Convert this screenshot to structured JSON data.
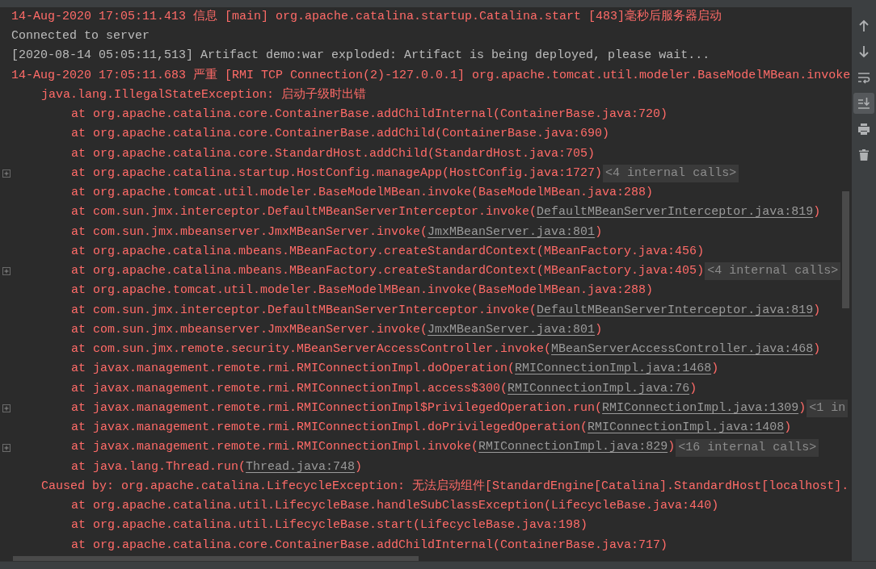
{
  "lines": [
    {
      "kind": "stderr",
      "segments": [
        {
          "text": "14-Aug-2020 17:05:11.413 信息 [main] org.apache.catalina.startup.Catalina.start [483]毫秒后服务器启动",
          "link": false
        }
      ]
    },
    {
      "kind": "stdout",
      "segments": [
        {
          "text": "Connected to server",
          "link": false
        }
      ]
    },
    {
      "kind": "stdout",
      "segments": [
        {
          "text": "[2020-08-14 05:05:11,513] Artifact demo:war exploded: Artifact is being deployed, please wait...",
          "link": false
        }
      ]
    },
    {
      "kind": "stderr",
      "segments": [
        {
          "text": "14-Aug-2020 17:05:11.683 严重 [RMI TCP Connection(2)-127.0.0.1] org.apache.tomcat.util.modeler.BaseModelMBean.invoke",
          "link": false
        }
      ],
      "children": [
        {
          "kind": "stderr",
          "segments": [
            {
              "text": "java.lang.IllegalStateException: 启动子级时出错",
              "link": false
            }
          ],
          "children": [
            {
              "kind": "stderr",
              "segments": [
                {
                  "text": "at org.apache.catalina.core.ContainerBase.addChildInternal(ContainerBase.java:720)",
                  "link": false
                }
              ]
            },
            {
              "kind": "stderr",
              "segments": [
                {
                  "text": "at org.apache.catalina.core.ContainerBase.addChild(ContainerBase.java:690)",
                  "link": false
                }
              ]
            },
            {
              "kind": "stderr",
              "segments": [
                {
                  "text": "at org.apache.catalina.core.StandardHost.addChild(StandardHost.java:705)",
                  "link": false
                }
              ]
            },
            {
              "kind": "stderr",
              "segments": [
                {
                  "text": "at org.apache.catalina.startup.HostConfig.manageApp(HostConfig.java:1727)",
                  "link": false
                }
              ],
              "internal_calls": "<4 internal calls>"
            },
            {
              "kind": "stderr",
              "segments": [
                {
                  "text": "at org.apache.tomcat.util.modeler.BaseModelMBean.invoke(BaseModelMBean.java:288)",
                  "link": false
                }
              ]
            },
            {
              "kind": "stderr",
              "segments": [
                {
                  "text": "at com.sun.jmx.interceptor.DefaultMBeanServerInterceptor.invoke(",
                  "link": false
                },
                {
                  "text": "DefaultMBeanServerInterceptor.java:819",
                  "link": true
                },
                {
                  "text": ")",
                  "link": false
                }
              ]
            },
            {
              "kind": "stderr",
              "segments": [
                {
                  "text": "at com.sun.jmx.mbeanserver.JmxMBeanServer.invoke(",
                  "link": false
                },
                {
                  "text": "JmxMBeanServer.java:801",
                  "link": true
                },
                {
                  "text": ")",
                  "link": false
                }
              ]
            },
            {
              "kind": "stderr",
              "segments": [
                {
                  "text": "at org.apache.catalina.mbeans.MBeanFactory.createStandardContext(MBeanFactory.java:456)",
                  "link": false
                }
              ]
            },
            {
              "kind": "stderr",
              "segments": [
                {
                  "text": "at org.apache.catalina.mbeans.MBeanFactory.createStandardContext(MBeanFactory.java:405)",
                  "link": false
                }
              ],
              "internal_calls": "<4 internal calls>"
            },
            {
              "kind": "stderr",
              "segments": [
                {
                  "text": "at org.apache.tomcat.util.modeler.BaseModelMBean.invoke(BaseModelMBean.java:288)",
                  "link": false
                }
              ]
            },
            {
              "kind": "stderr",
              "segments": [
                {
                  "text": "at com.sun.jmx.interceptor.DefaultMBeanServerInterceptor.invoke(",
                  "link": false
                },
                {
                  "text": "DefaultMBeanServerInterceptor.java:819",
                  "link": true
                },
                {
                  "text": ")",
                  "link": false
                }
              ]
            },
            {
              "kind": "stderr",
              "segments": [
                {
                  "text": "at com.sun.jmx.mbeanserver.JmxMBeanServer.invoke(",
                  "link": false
                },
                {
                  "text": "JmxMBeanServer.java:801",
                  "link": true
                },
                {
                  "text": ")",
                  "link": false
                }
              ]
            },
            {
              "kind": "stderr",
              "segments": [
                {
                  "text": "at com.sun.jmx.remote.security.MBeanServerAccessController.invoke(",
                  "link": false
                },
                {
                  "text": "MBeanServerAccessController.java:468",
                  "link": true
                },
                {
                  "text": ")",
                  "link": false
                }
              ]
            },
            {
              "kind": "stderr",
              "segments": [
                {
                  "text": "at javax.management.remote.rmi.RMIConnectionImpl.doOperation(",
                  "link": false
                },
                {
                  "text": "RMIConnectionImpl.java:1468",
                  "link": true
                },
                {
                  "text": ")",
                  "link": false
                }
              ]
            },
            {
              "kind": "stderr",
              "segments": [
                {
                  "text": "at javax.management.remote.rmi.RMIConnectionImpl.access$300(",
                  "link": false
                },
                {
                  "text": "RMIConnectionImpl.java:76",
                  "link": true
                },
                {
                  "text": ")",
                  "link": false
                }
              ]
            },
            {
              "kind": "stderr",
              "segments": [
                {
                  "text": "at javax.management.remote.rmi.RMIConnectionImpl$PrivilegedOperation.run(",
                  "link": false
                },
                {
                  "text": "RMIConnectionImpl.java:1309",
                  "link": true
                },
                {
                  "text": ")",
                  "link": false
                }
              ],
              "internal_calls": "<1 in"
            },
            {
              "kind": "stderr",
              "segments": [
                {
                  "text": "at javax.management.remote.rmi.RMIConnectionImpl.doPrivilegedOperation(",
                  "link": false
                },
                {
                  "text": "RMIConnectionImpl.java:1408",
                  "link": true
                },
                {
                  "text": ")",
                  "link": false
                }
              ]
            },
            {
              "kind": "stderr",
              "segments": [
                {
                  "text": "at javax.management.remote.rmi.RMIConnectionImpl.invoke(",
                  "link": false
                },
                {
                  "text": "RMIConnectionImpl.java:829",
                  "link": true
                },
                {
                  "text": ")",
                  "link": false
                }
              ],
              "internal_calls": "<16 internal calls>"
            },
            {
              "kind": "stderr",
              "segments": [
                {
                  "text": "at java.lang.Thread.run(",
                  "link": false
                },
                {
                  "text": "Thread.java:748",
                  "link": true
                },
                {
                  "text": ")",
                  "link": false
                }
              ]
            }
          ]
        },
        {
          "kind": "stderr",
          "segments": [
            {
              "text": "Caused by: org.apache.catalina.LifecycleException: 无法启动组件[StandardEngine[Catalina].StandardHost[localhost].",
              "link": false
            }
          ],
          "children": [
            {
              "kind": "stderr",
              "segments": [
                {
                  "text": "at org.apache.catalina.util.LifecycleBase.handleSubClassException(LifecycleBase.java:440)",
                  "link": false
                }
              ]
            },
            {
              "kind": "stderr",
              "segments": [
                {
                  "text": "at org.apache.catalina.util.LifecycleBase.start(LifecycleBase.java:198)",
                  "link": false
                }
              ]
            },
            {
              "kind": "stderr",
              "segments": [
                {
                  "text": "at org.apache.catalina.core.ContainerBase.addChildInternal(ContainerBase.java:717)",
                  "link": false
                }
              ]
            }
          ]
        }
      ]
    }
  ],
  "toolbar": [
    {
      "kind": "up",
      "selected": false
    },
    {
      "kind": "down",
      "selected": false
    },
    {
      "kind": "soft-wrap",
      "selected": false
    },
    {
      "kind": "scroll-to-end",
      "selected": true
    },
    {
      "kind": "print",
      "selected": false
    },
    {
      "kind": "clear",
      "selected": false
    }
  ]
}
